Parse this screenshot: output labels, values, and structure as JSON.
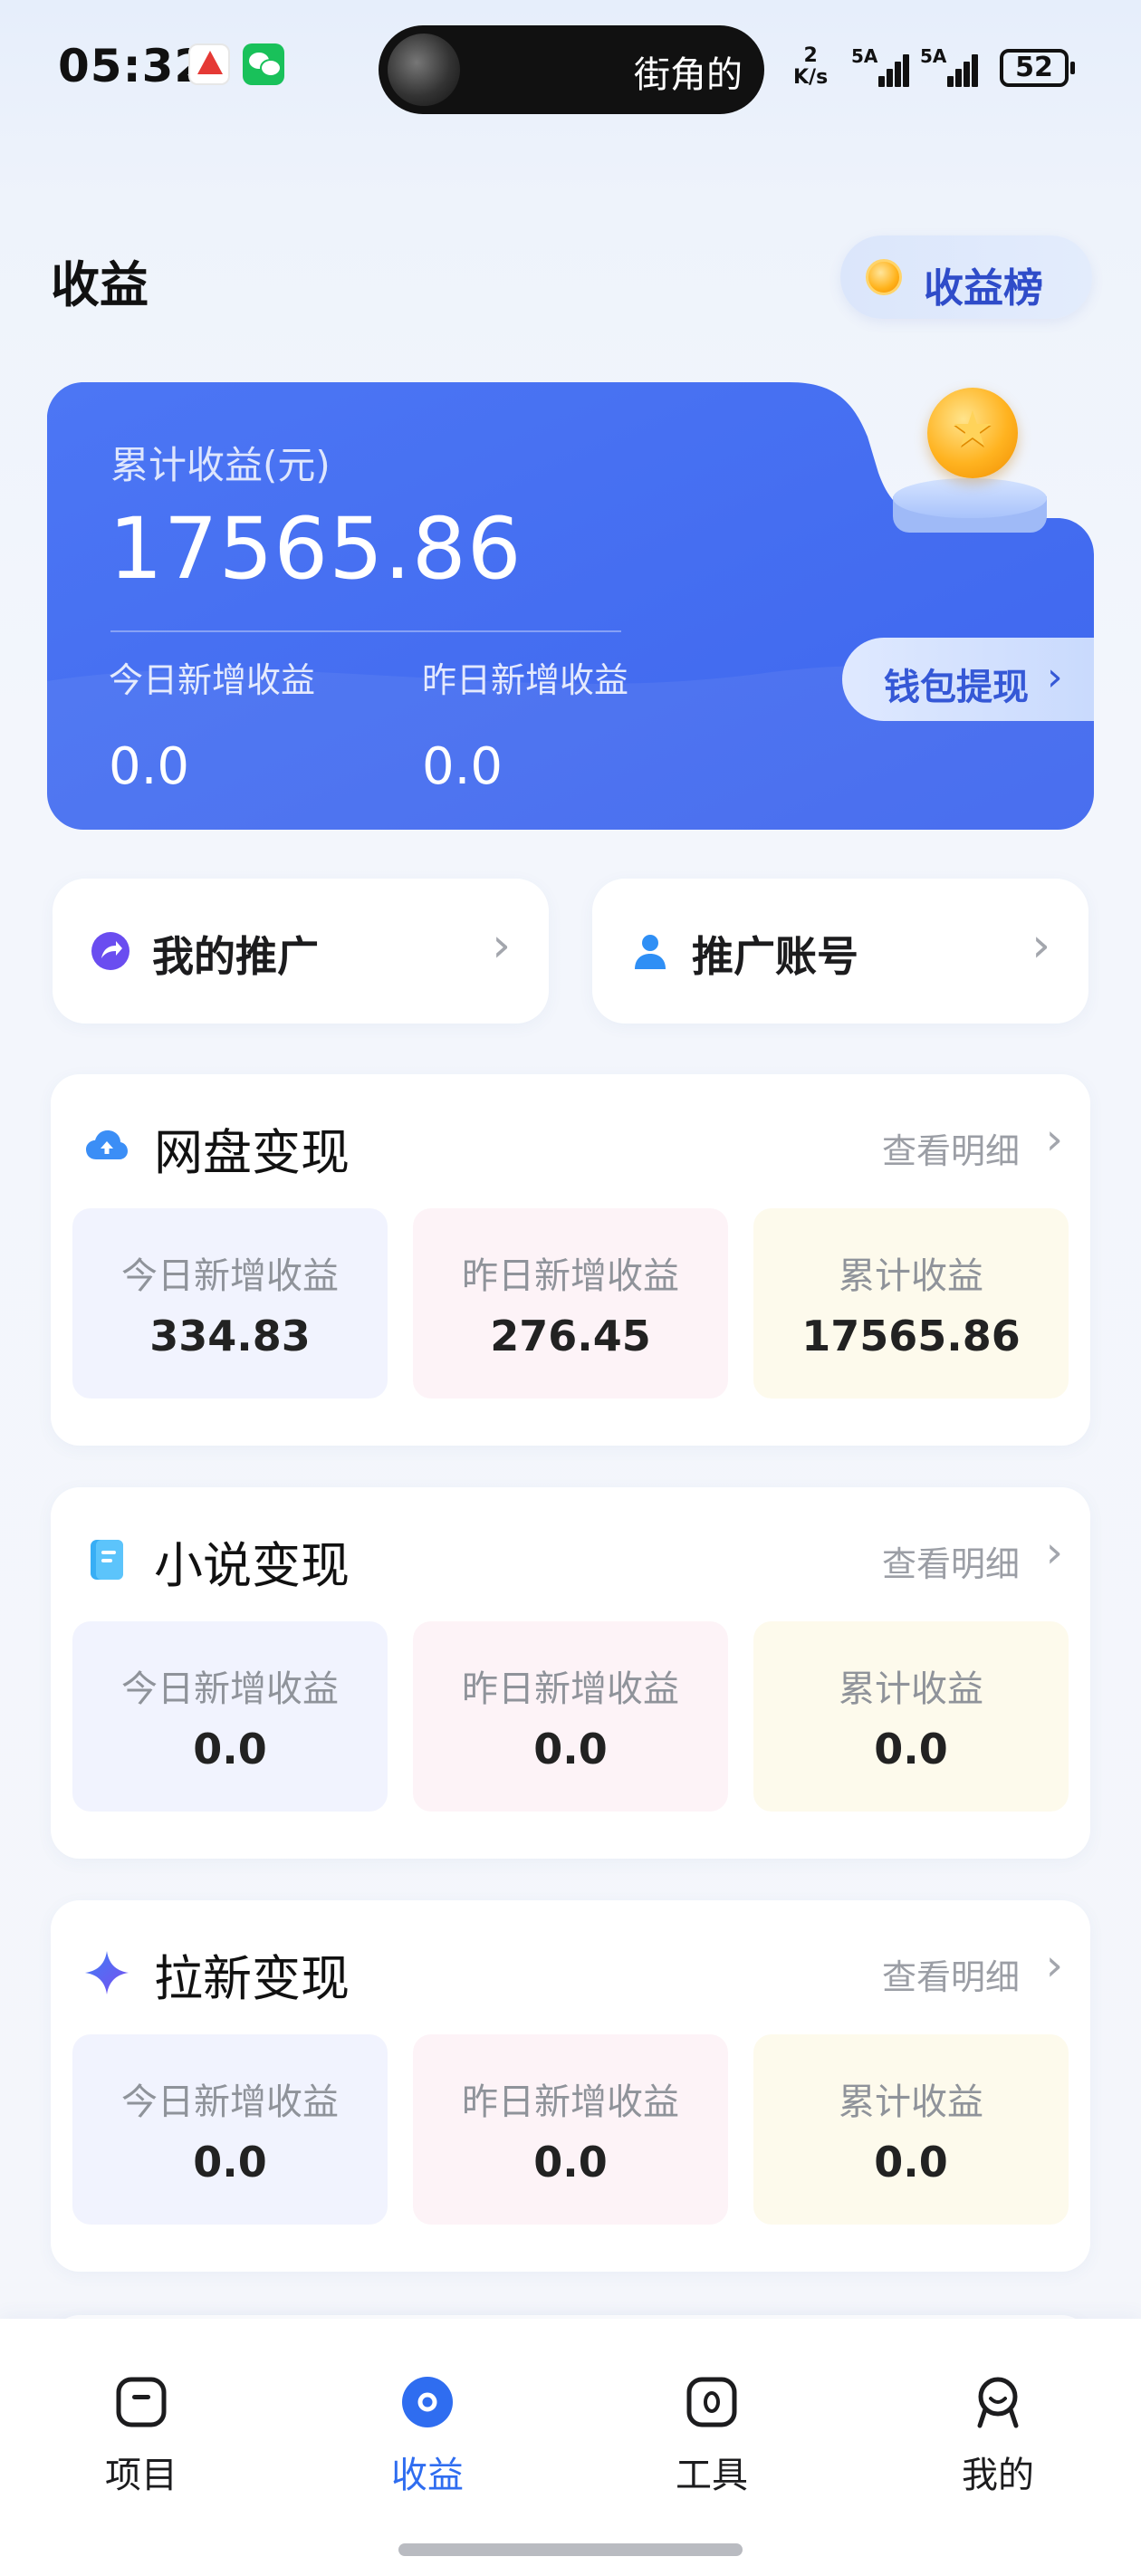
{
  "status_bar": {
    "time": "05:32",
    "island_text": "街角的",
    "net_speed_value": "2",
    "net_speed_unit": "K/s",
    "signal1_label": "5A",
    "signal2_label": "5A",
    "battery": "52"
  },
  "header": {
    "title": "收益",
    "rank_button_label": "收益榜"
  },
  "earnings_card": {
    "total_label": "累计收益(元)",
    "total_value": "17565.86",
    "today_label": "今日新增收益",
    "today_value": "0.0",
    "yesterday_label": "昨日新增收益",
    "yesterday_value": "0.0",
    "withdraw_label": "钱包提现",
    "colors": {
      "card_start": "#4a73f3",
      "card_end": "#3f67ee"
    }
  },
  "promo": {
    "my_promotion": {
      "label": "我的推广",
      "icon": "share-arrow-icon"
    },
    "promo_account": {
      "label": "推广账号",
      "icon": "person-icon"
    }
  },
  "sections": [
    {
      "title": "网盘变现",
      "icon": "cloud-upload-icon",
      "link": "查看明细",
      "today_label": "今日新增收益",
      "today_value": "334.83",
      "yesterday_label": "昨日新增收益",
      "yesterday_value": "276.45",
      "total_label": "累计收益",
      "total_value": "17565.86"
    },
    {
      "title": "小说变现",
      "icon": "book-icon",
      "link": "查看明细",
      "today_label": "今日新增收益",
      "today_value": "0.0",
      "yesterday_label": "昨日新增收益",
      "yesterday_value": "0.0",
      "total_label": "累计收益",
      "total_value": "0.0"
    },
    {
      "title": "拉新变现",
      "icon": "sparkle-icon",
      "link": "查看明细",
      "today_label": "今日新增收益",
      "today_value": "0.0",
      "yesterday_label": "昨日新增收益",
      "yesterday_value": "0.0",
      "total_label": "累计收益",
      "total_value": "0.0"
    }
  ],
  "bottom_nav": {
    "items": [
      {
        "label": "项目",
        "icon": "project-icon",
        "active": false
      },
      {
        "label": "收益",
        "icon": "earnings-icon",
        "active": true
      },
      {
        "label": "工具",
        "icon": "tools-icon",
        "active": false
      },
      {
        "label": "我的",
        "icon": "profile-icon",
        "active": false
      }
    ],
    "colors": {
      "active": "#2f6df0",
      "inactive": "#1c1c1e"
    }
  }
}
